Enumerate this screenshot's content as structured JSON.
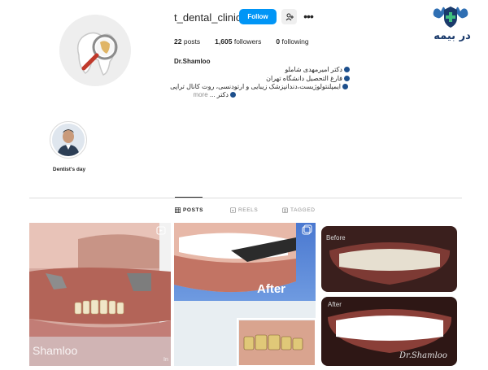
{
  "profile": {
    "username": "t_dental_clinic",
    "follow_label": "Follow",
    "more_label": "•••",
    "stats": {
      "posts_count": "22",
      "posts_label": "posts",
      "followers_count": "1,605",
      "followers_label": "followers",
      "following_count": "0",
      "following_label": "following"
    },
    "bio": {
      "name": "Dr.Shamloo",
      "line1": "دکتر امیرمهدی شاملو",
      "line2": "فارغ التحصیل دانشگاه تهران",
      "line3": "ایمپلنتولوژیست،دندانپزشک زیبایی و ارتودنسی، روت کانال تراپی",
      "line4": "دکتر ...",
      "more_label": "more"
    }
  },
  "logo": {
    "text": "در بیمه"
  },
  "highlights": [
    {
      "label": "Dentist's day"
    }
  ],
  "tabs": [
    {
      "label": "POSTS",
      "active": true,
      "icon": "grid-icon"
    },
    {
      "label": "REELS",
      "active": false,
      "icon": "reels-icon"
    },
    {
      "label": "TAGGED",
      "active": false,
      "icon": "tagged-icon"
    }
  ],
  "posts": {
    "post1": {
      "watermark": "Shamloo",
      "tail": "In"
    },
    "post2": {
      "overlay": "After"
    },
    "post3": {
      "before_label": "Before",
      "after_label": "After",
      "signature": "Dr.Shamloo"
    }
  },
  "colors": {
    "accent": "#0095f6",
    "text": "#262626",
    "muted": "#8e8e8e",
    "brand": "#1a3a6b"
  }
}
